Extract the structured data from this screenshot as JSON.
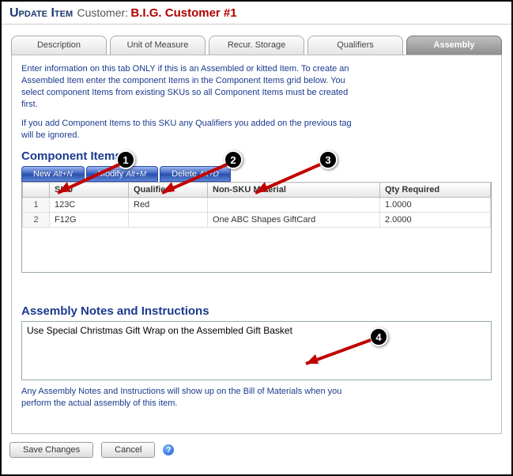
{
  "header": {
    "title": "Update Item",
    "customer_label": "Customer:",
    "customer_name": "B.I.G. Customer #1"
  },
  "tabs": {
    "items": [
      {
        "label": "Description"
      },
      {
        "label": "Unit of Measure"
      },
      {
        "label": "Recur. Storage"
      },
      {
        "label": "Qualifiers"
      },
      {
        "label": "Assembly"
      }
    ],
    "active_index": 4
  },
  "info": {
    "p1": "Enter information on this tab ONLY if this is an Assembled or kitted Item. To create an Assembled Item enter the component Items in the Component Items grid below. You select component Items from existing SKUs so all Component Items must be created first.",
    "p2": "If you add Component Items to this SKU any Qualifiers you added on the previous tag will be ignored."
  },
  "component": {
    "title": "Component Items",
    "buttons": {
      "new": {
        "label": "New",
        "hint": "Alt+N"
      },
      "modify": {
        "label": "Modify",
        "hint": "Alt+M"
      },
      "delete": {
        "label": "Delete",
        "hint": "Alt+D"
      }
    },
    "columns": {
      "rownum": "",
      "sku": "SKU",
      "qualifier": "Qualifier",
      "nonsku": "Non-SKU Material",
      "qty": "Qty Required"
    },
    "rows": [
      {
        "n": "1",
        "sku": "123C",
        "qualifier": "Red",
        "nonsku": "",
        "qty": "1.0000"
      },
      {
        "n": "2",
        "sku": "F12G",
        "qualifier": "",
        "nonsku": "One ABC Shapes GiftCard",
        "qty": "2.0000"
      }
    ]
  },
  "notes": {
    "title": "Assembly Notes and Instructions",
    "value": "Use Special Christmas Gift Wrap on the Assembled Gift Basket",
    "footer": "Any Assembly Notes and Instructions will show up on the Bill of Materials when you perform the actual assembly of this item."
  },
  "footer_buttons": {
    "save": "Save Changes",
    "cancel": "Cancel",
    "help": "?"
  },
  "annotations": {
    "b1": "1",
    "b2": "2",
    "b3": "3",
    "b4": "4"
  }
}
